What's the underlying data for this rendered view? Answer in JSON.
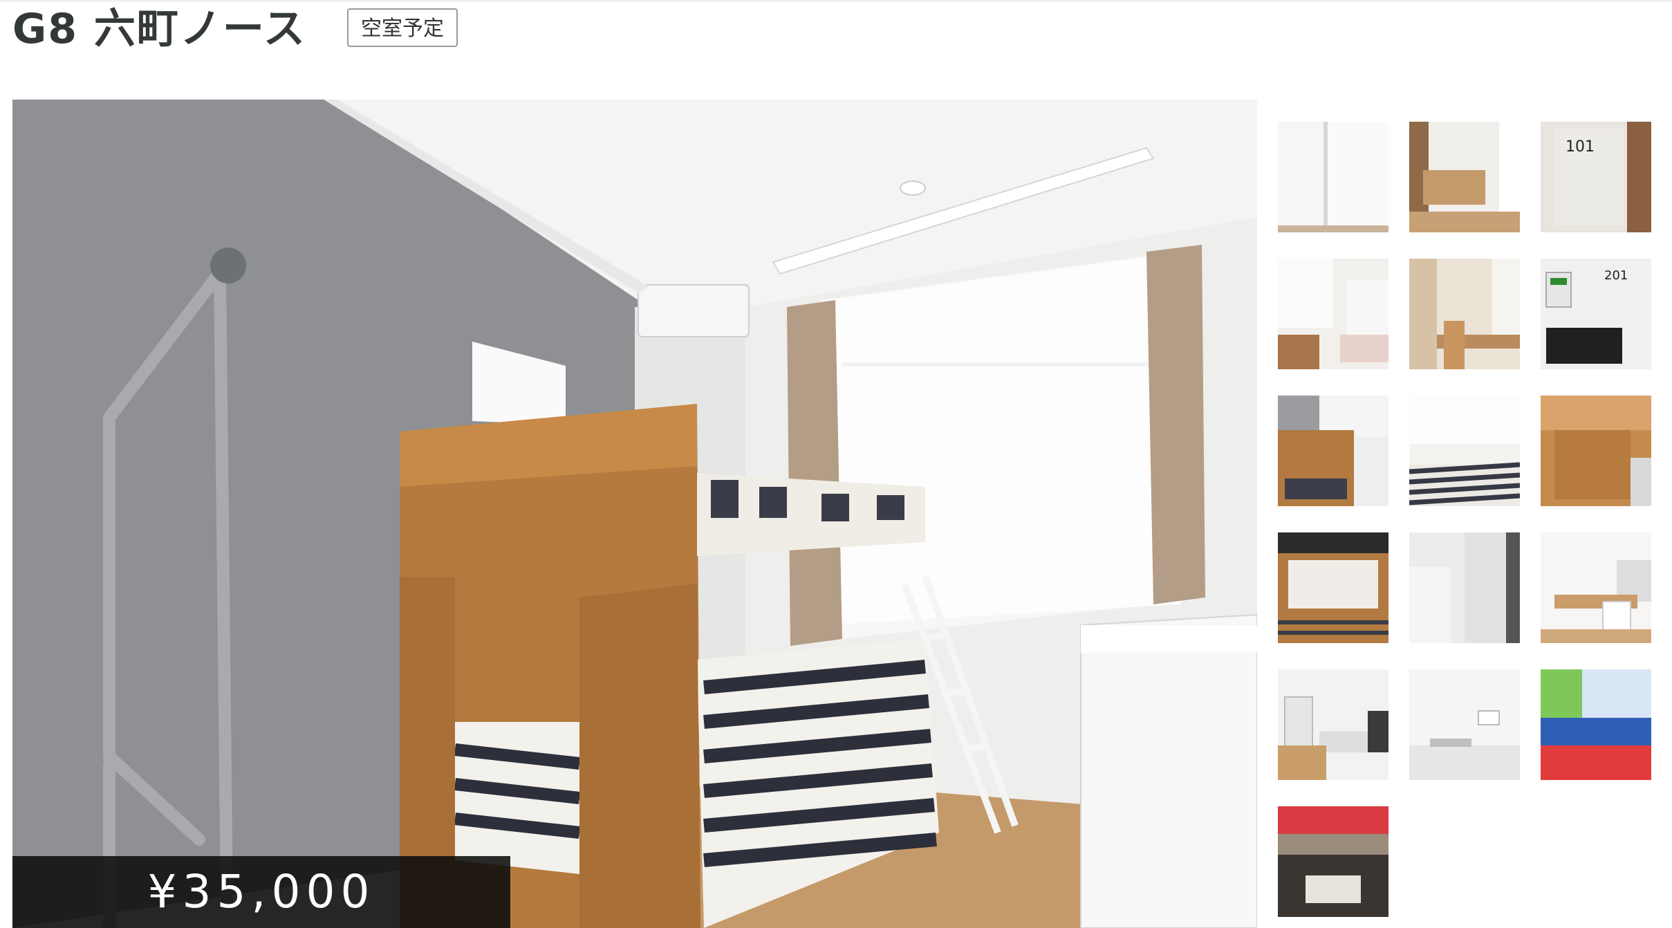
{
  "listing": {
    "title": "G8 六町ノース",
    "badge": "空室予定",
    "price": "¥35,000"
  },
  "main_photo": {
    "icon": "bedroom-photo"
  },
  "thumbnails": [
    {
      "name": "thumb-window",
      "caption": ""
    },
    {
      "name": "thumb-dining-hallway",
      "caption": ""
    },
    {
      "name": "thumb-door-101",
      "caption": "101"
    },
    {
      "name": "thumb-room-bed",
      "caption": ""
    },
    {
      "name": "thumb-desk-chair",
      "caption": ""
    },
    {
      "name": "thumb-door-201",
      "caption": "201"
    },
    {
      "name": "thumb-bunk-bed",
      "caption": ""
    },
    {
      "name": "thumb-striped-bed",
      "caption": ""
    },
    {
      "name": "thumb-shelf-closeup",
      "caption": ""
    },
    {
      "name": "thumb-lower-bunk",
      "caption": ""
    },
    {
      "name": "thumb-closet",
      "caption": ""
    },
    {
      "name": "thumb-dining-room",
      "caption": ""
    },
    {
      "name": "thumb-kitchen",
      "caption": ""
    },
    {
      "name": "thumb-kitchen-sink",
      "caption": ""
    },
    {
      "name": "thumb-supplies",
      "caption": ""
    },
    {
      "name": "thumb-station",
      "caption": ""
    }
  ]
}
